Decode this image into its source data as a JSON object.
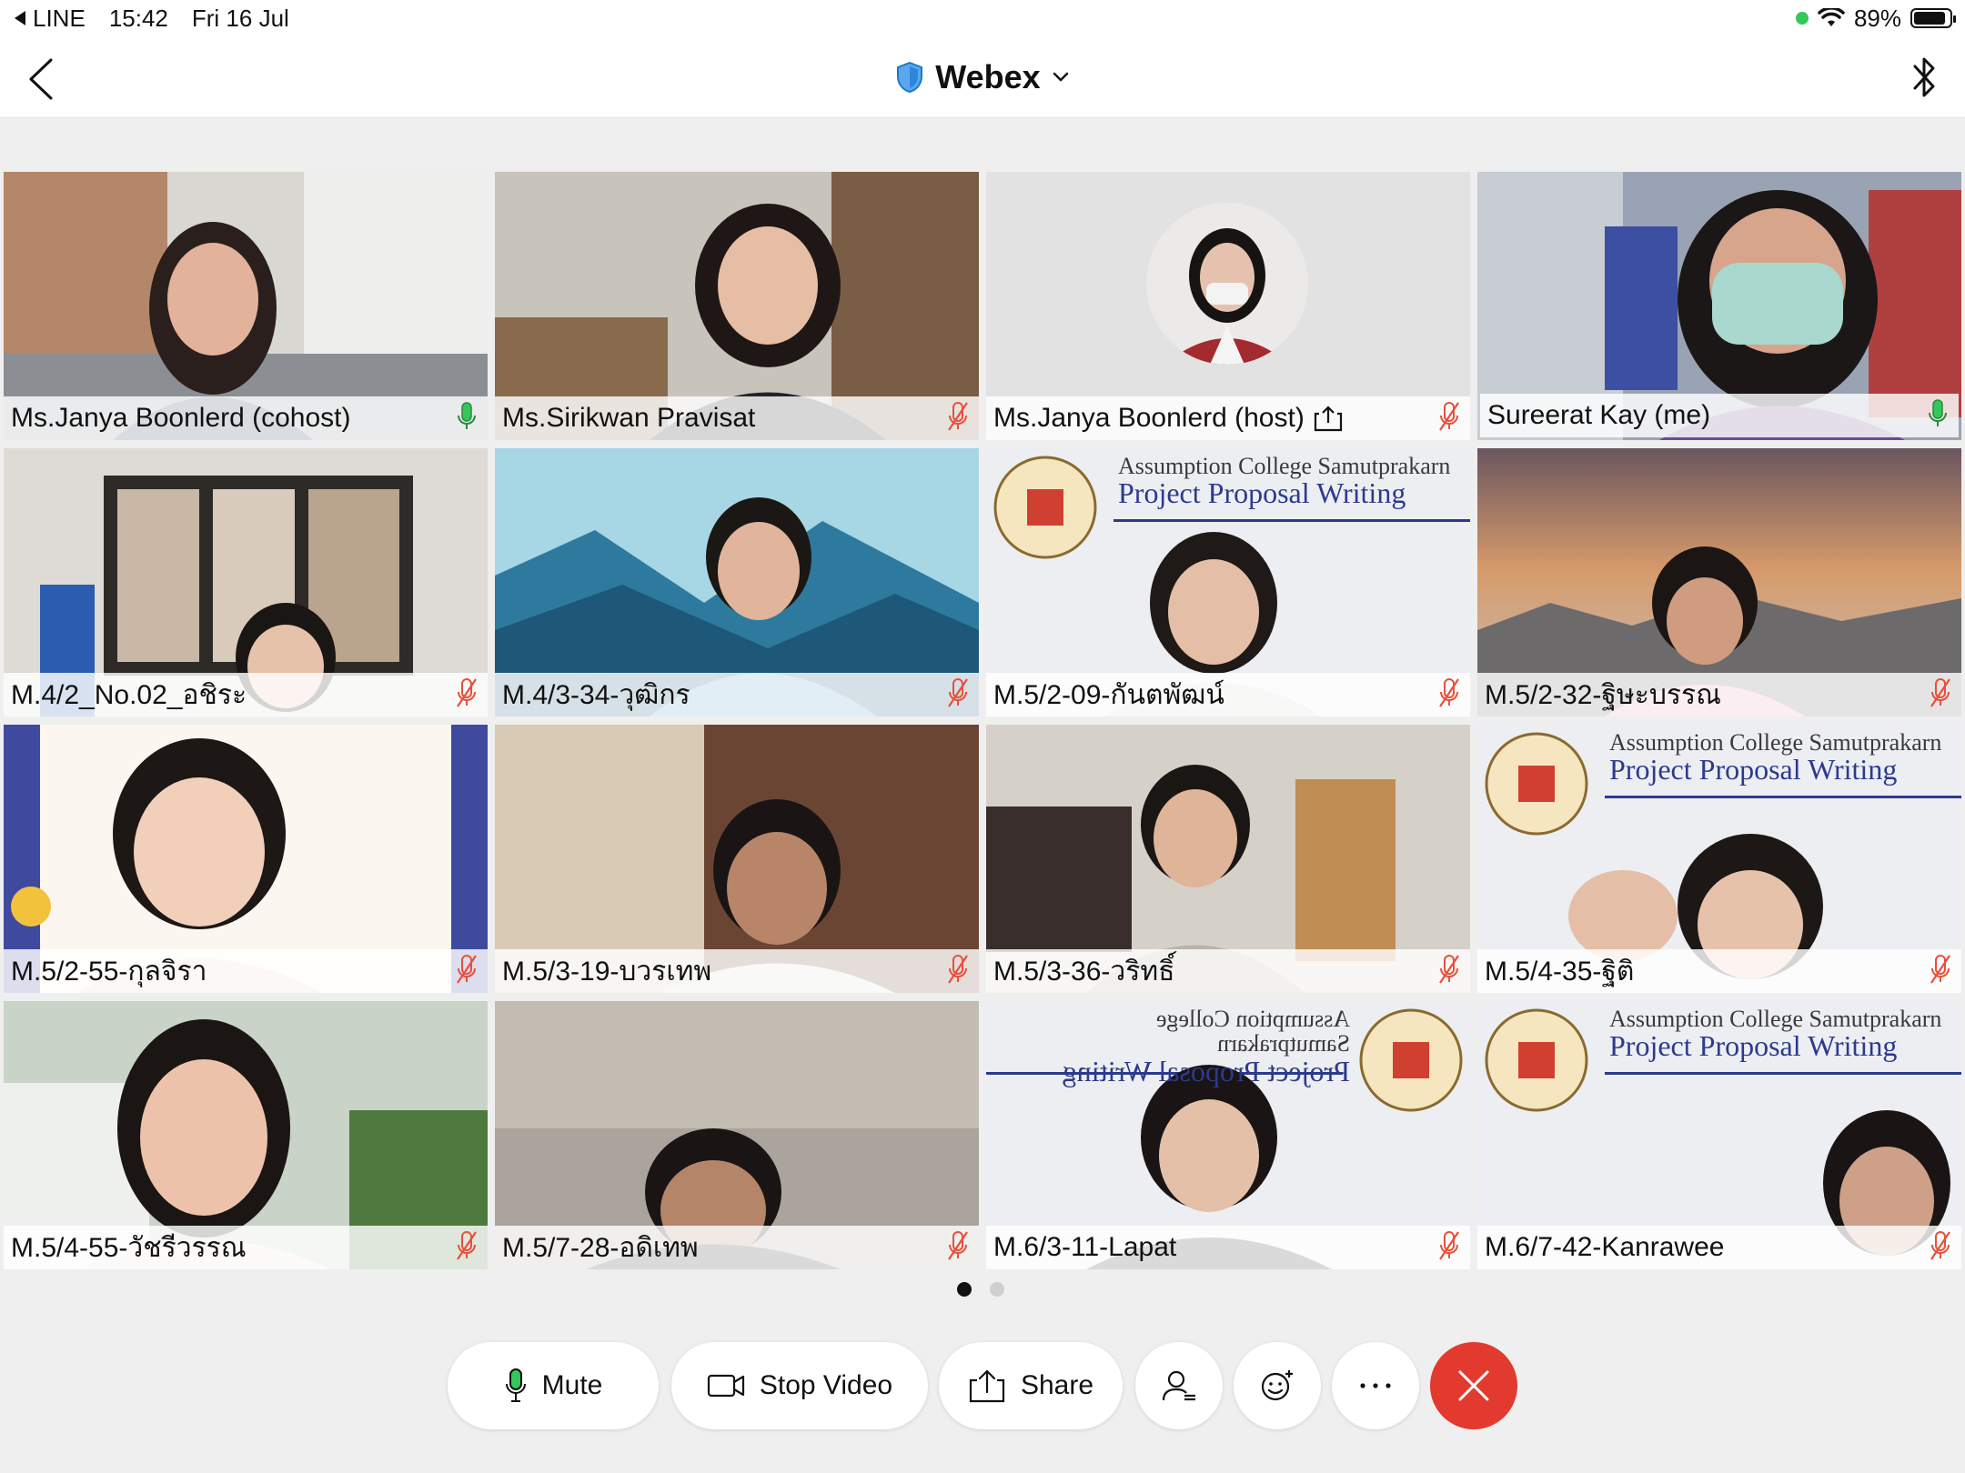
{
  "status_bar": {
    "back_app": "LINE",
    "time": "15:42",
    "date": "Fri 16 Jul",
    "battery": "89%",
    "battery_level": 0.89
  },
  "header": {
    "title": "Webex"
  },
  "participants": [
    {
      "name": "Ms.Janya Boonlerd (cohost)",
      "mic": "on"
    },
    {
      "name": "Ms.Sirikwan Pravisat",
      "mic": "muted"
    },
    {
      "name": "Ms.Janya Boonlerd (host)",
      "mic": "muted",
      "sharing": true
    },
    {
      "name": "Sureerat Kay (me)",
      "mic": "on",
      "active": true
    },
    {
      "name": "M.4/2_No.02_อชิระ",
      "mic": "muted"
    },
    {
      "name": "M.4/3-34-วุฒิกร",
      "mic": "muted"
    },
    {
      "name": "M.5/2-09-กันตพัฒน์",
      "mic": "muted"
    },
    {
      "name": "M.5/2-32-ฐิษะบรรณ",
      "mic": "muted"
    },
    {
      "name": "M.5/2-55-กุลจิรา",
      "mic": "muted"
    },
    {
      "name": "M.5/3-19-บวรเทพ",
      "mic": "muted"
    },
    {
      "name": "M.5/3-36-วริทธิ์",
      "mic": "muted"
    },
    {
      "name": "M.5/4-35-ฐิติ",
      "mic": "muted"
    },
    {
      "name": "M.5/4-55-วัชรีวรรณ",
      "mic": "muted"
    },
    {
      "name": "M.5/7-28-อดิเทพ",
      "mic": "muted"
    },
    {
      "name": "M.6/3-11-Lapat",
      "mic": "muted"
    },
    {
      "name": "M.6/7-42-Kanrawee",
      "mic": "muted"
    }
  ],
  "controls": {
    "mute_label": "Mute",
    "stop_video_label": "Stop Video",
    "share_label": "Share"
  },
  "colors": {
    "accent": "#1a79c9",
    "mic_on": "#34c759",
    "mic_muted": "#e8503a",
    "end_call": "#e23a2e"
  }
}
